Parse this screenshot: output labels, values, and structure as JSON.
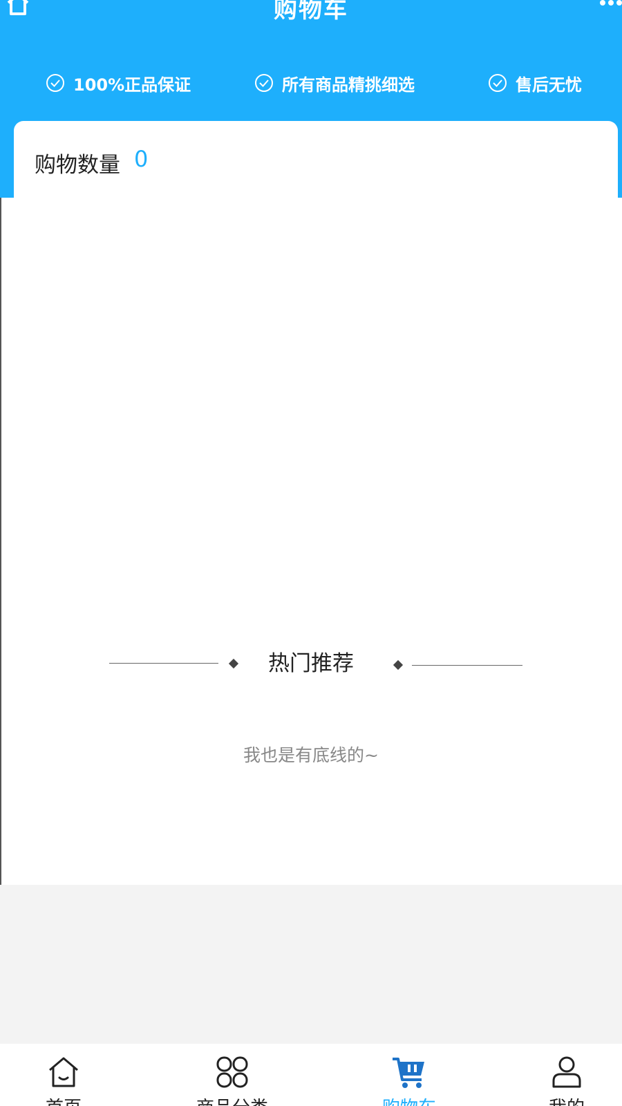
{
  "header": {
    "title": "购物车",
    "home_icon": "home-outline-icon",
    "more_icon": "more-dots-icon",
    "background": "#1eaffc"
  },
  "guarantees": [
    {
      "icon": "check-circle-icon",
      "label": "100%正品保证"
    },
    {
      "icon": "check-circle-icon",
      "label": "所有商品精挑细选"
    },
    {
      "icon": "check-circle-icon",
      "label": "售后无忧"
    }
  ],
  "cart": {
    "count_label": "购物数量",
    "count_value": "0"
  },
  "hot": {
    "title": "热门推荐",
    "end_text": "我也是有底线的~"
  },
  "tabbar": {
    "active_color": "#1eaffc",
    "items": [
      {
        "label": "首页",
        "icon": "home-icon"
      },
      {
        "label": "商品分类",
        "icon": "category-grid-icon"
      },
      {
        "label": "购物车",
        "icon": "shopping-cart-icon",
        "active": true
      },
      {
        "label": "我的",
        "icon": "user-icon"
      }
    ]
  }
}
